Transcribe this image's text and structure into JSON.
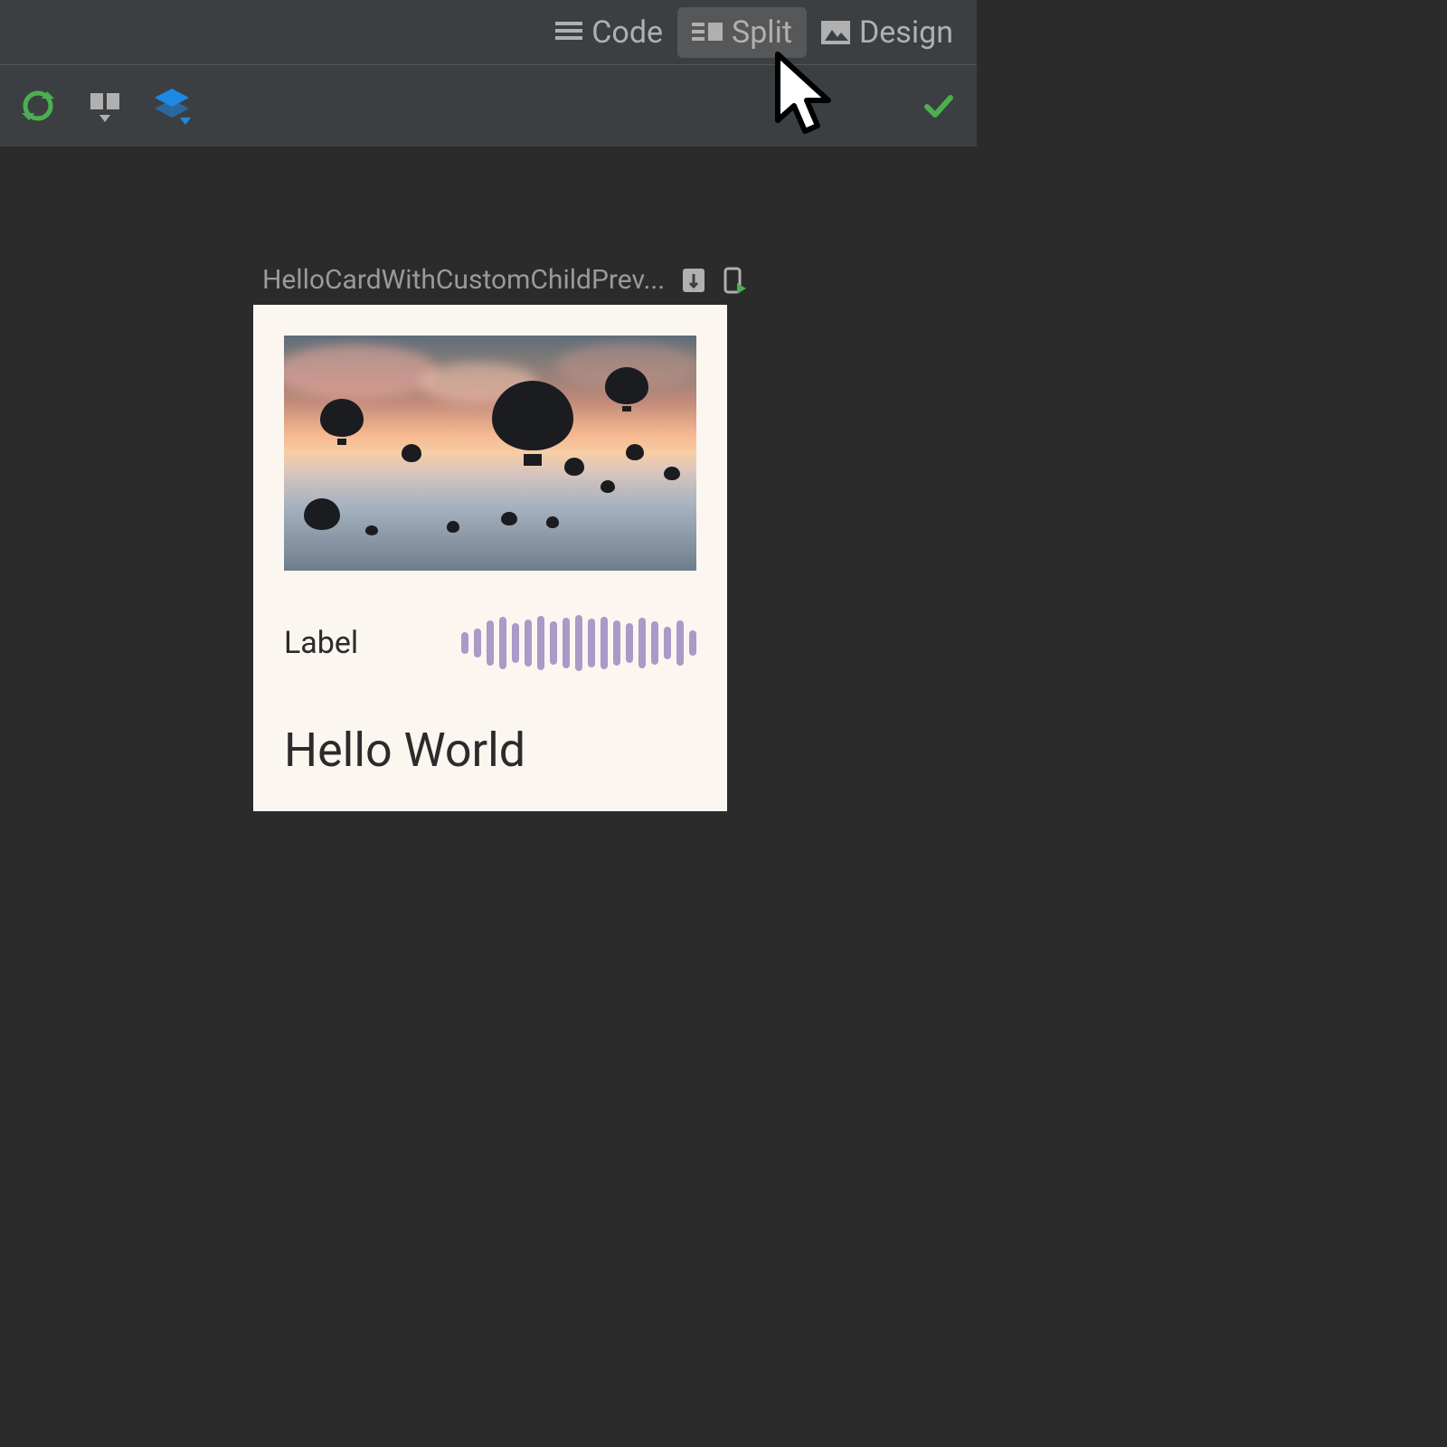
{
  "viewModes": {
    "code": {
      "label": "Code",
      "selected": false
    },
    "split": {
      "label": "Split",
      "selected": true
    },
    "design": {
      "label": "Design",
      "selected": false
    }
  },
  "preview": {
    "name": "HelloCardWithCustomChildPrev..."
  },
  "card": {
    "label": "Label",
    "title": "Hello World"
  },
  "waveform_heights": [
    24,
    32,
    50,
    58,
    44,
    52,
    60,
    48,
    56,
    62,
    54,
    58,
    50,
    44,
    56,
    48,
    36,
    50,
    28
  ],
  "colors": {
    "accent_green": "#4caf50",
    "accent_blue": "#1e88e5",
    "wave": "#a99ac8"
  }
}
